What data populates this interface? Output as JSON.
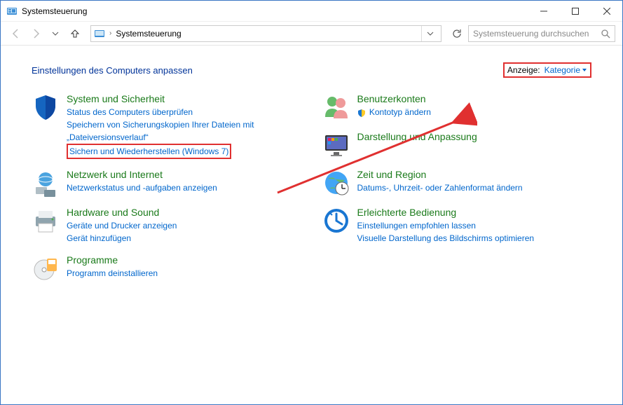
{
  "window": {
    "title": "Systemsteuerung"
  },
  "addressbar": {
    "crumb": "Systemsteuerung"
  },
  "search": {
    "placeholder": "Systemsteuerung durchsuchen"
  },
  "header": {
    "title": "Einstellungen des Computers anpassen",
    "view_label": "Anzeige:",
    "view_value": "Kategorie"
  },
  "categories": {
    "system_security": {
      "title": "System und Sicherheit",
      "task1": "Status des Computers überprüfen",
      "task2": "Speichern von Sicherungskopien Ihrer Dateien mit „Dateiversionsverlauf“",
      "task3": "Sichern und Wiederherstellen (Windows 7)"
    },
    "network": {
      "title": "Netzwerk und Internet",
      "task1": "Netzwerkstatus und -aufgaben anzeigen"
    },
    "hardware": {
      "title": "Hardware und Sound",
      "task1": "Geräte und Drucker anzeigen",
      "task2": "Gerät hinzufügen"
    },
    "programs": {
      "title": "Programme",
      "task1": "Programm deinstallieren"
    },
    "users": {
      "title": "Benutzerkonten",
      "task1": "Kontotyp ändern"
    },
    "appearance": {
      "title": "Darstellung und Anpassung"
    },
    "time": {
      "title": "Zeit und Region",
      "task1": "Datums-, Uhrzeit- oder Zahlenformat ändern"
    },
    "ease": {
      "title": "Erleichterte Bedienung",
      "task1": "Einstellungen empfohlen lassen",
      "task2": "Visuelle Darstellung des Bildschirms optimieren"
    }
  }
}
